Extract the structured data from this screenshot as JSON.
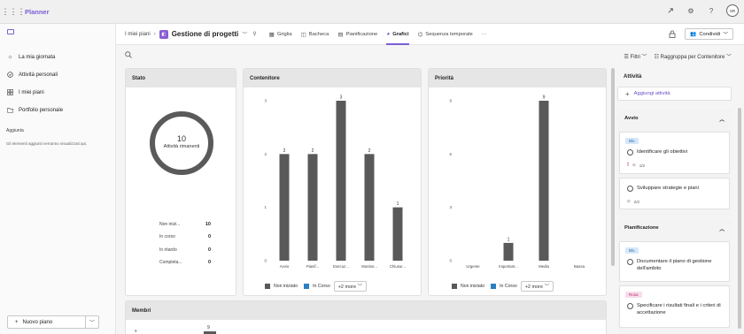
{
  "app": {
    "title": "Planner",
    "user_initials": "SR"
  },
  "sidebar": {
    "items": [
      {
        "label": "La mia giornata",
        "icon": "sun-icon"
      },
      {
        "label": "Attività personali",
        "icon": "checkbox-icon"
      },
      {
        "label": "I miei piani",
        "icon": "grid-icon"
      },
      {
        "label": "Portfolio personale",
        "icon": "folder-icon"
      }
    ],
    "section_label": "Aggiunta",
    "section_hint": "Gli elementi aggiunti verranno visualizzati qui.",
    "new_plan_label": "Nuovo piano"
  },
  "header": {
    "breadcrumb_root": "I miei piani",
    "plan_name": "Gestione di progetti",
    "plan_icon_color": "#8a5cd6",
    "tabs": [
      {
        "label": "Griglia",
        "icon": "grid-icon"
      },
      {
        "label": "Bacheca",
        "icon": "board-icon"
      },
      {
        "label": "Pianificazione",
        "icon": "calendar-icon"
      },
      {
        "label": "Grafici",
        "icon": "chart-icon",
        "active": true
      },
      {
        "label": "Sequenza temporale",
        "icon": "timeline-icon"
      }
    ],
    "more_label": "···",
    "share_label": "Condividi"
  },
  "toolbar": {
    "filter_label": "Filtri",
    "group_label": "Raggruppa per Contenitore"
  },
  "cards": {
    "stato": {
      "title": "Stato",
      "remaining_count": "10",
      "remaining_label": "Attività rimanenti",
      "rows": [
        {
          "label": "Non inizi...",
          "value": "10"
        },
        {
          "label": "In corso",
          "value": "0"
        },
        {
          "label": "In ritardo",
          "value": "0"
        },
        {
          "label": "Completa...",
          "value": "0"
        }
      ]
    },
    "contenitore": {
      "title": "Contenitore"
    },
    "priorita": {
      "title": "Priorità"
    },
    "membri": {
      "title": "Membri",
      "y_tick": "9",
      "bar_value": "9",
      "bar_value_fraction": 1.0
    },
    "legend": {
      "not_started": "Non iniziato",
      "in_progress": "In Corso",
      "more": "+2 more",
      "color_not_started": "#595959",
      "color_in_progress": "#2d7fc1"
    }
  },
  "chart_data": [
    {
      "type": "bar",
      "title": "Contenitore",
      "categories": [
        "Avvio",
        "Pianif...",
        "Esecuz...",
        "Monitor...",
        "Chiusur..."
      ],
      "series": [
        {
          "name": "Non iniziato",
          "values": [
            2,
            2,
            3,
            2,
            1
          ]
        }
      ],
      "y_ticks": [
        "0",
        "1",
        "2",
        "3"
      ],
      "ylim": [
        0,
        3
      ],
      "legend": "bottom"
    },
    {
      "type": "bar",
      "title": "Priorità",
      "categories": [
        "Urgente",
        "Important...",
        "Media",
        "Bassa"
      ],
      "series": [
        {
          "name": "Non iniziato",
          "values": [
            0,
            1,
            9,
            0
          ]
        }
      ],
      "y_ticks": [
        "0",
        "3",
        "6",
        "9"
      ],
      "ylim": [
        0,
        9
      ],
      "legend": "bottom"
    }
  ],
  "panel": {
    "title": "Attività",
    "add_task_label": "Aggiungi attività",
    "buckets": [
      {
        "name": "Avvio",
        "tasks": [
          {
            "tag": "Blu",
            "tag_bg": "#d6e8f8",
            "tag_fg": "#2d6fb0",
            "title": "Identificare gli obiettivi",
            "priority_mark": "!",
            "checklist": "1/2"
          },
          {
            "title": "Sviluppare strategie e piani",
            "checklist": "2/2"
          }
        ]
      },
      {
        "name": "Pianificazione",
        "tasks": [
          {
            "tag": "Blu",
            "tag_bg": "#d6e8f8",
            "tag_fg": "#2d6fb0",
            "title": "Documentare il piano di gestione dell'ambito"
          },
          {
            "tag": "Rosa",
            "tag_bg": "#f8dcea",
            "tag_fg": "#b0306f",
            "title": "Specificare i risultati finali e i criteri di accettazione"
          }
        ]
      }
    ]
  }
}
